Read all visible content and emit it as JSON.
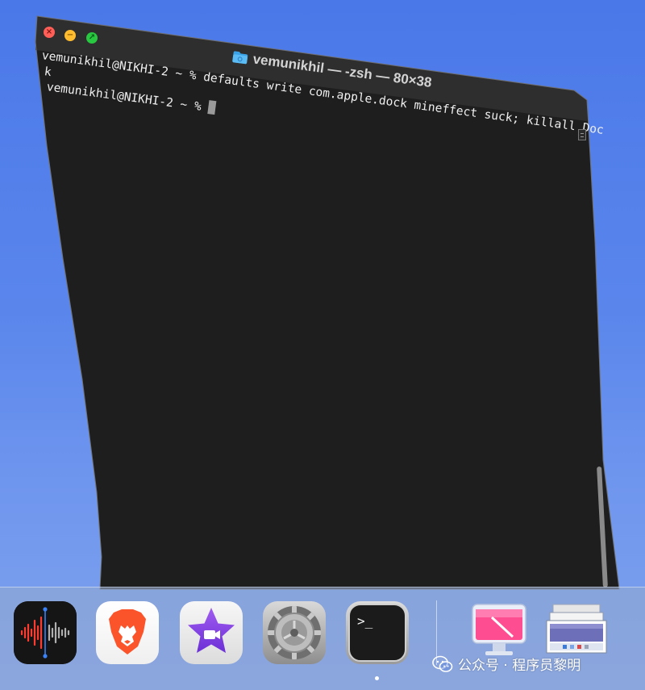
{
  "window": {
    "title": "vemunikhil — -zsh — 80×38",
    "folder_icon": "folder-icon",
    "traffic_lights": {
      "close_color": "#ff5f57",
      "minimize_color": "#febc2e",
      "zoom_color": "#28c840",
      "close_glyph": "×",
      "minimize_glyph": "−",
      "zoom_glyph": "↗"
    }
  },
  "terminal": {
    "lines": [
      "vemunikhil@NIKHI-2 ~ % defaults write com.apple.dock mineffect suck; killall Doc",
      "k",
      "vemunikhil@NIKHI-2 ~ % "
    ],
    "background_color": "#1e1e1e",
    "text_color": "#f0f0f0"
  },
  "dock": {
    "apps": [
      {
        "name": "Voice Memos",
        "icon": "voice-memos-icon"
      },
      {
        "name": "Brave Browser",
        "icon": "brave-lion-icon"
      },
      {
        "name": "iMovie",
        "icon": "imovie-star-icon"
      },
      {
        "name": "System Settings",
        "icon": "gear-icon"
      },
      {
        "name": "Terminal",
        "icon": "terminal-icon",
        "running": true
      },
      {
        "name": "CleanMyMac",
        "icon": "cleanmymac-icon"
      },
      {
        "name": "Downloads",
        "icon": "downloads-stack-icon"
      }
    ],
    "terminal_icon_text": ">_"
  },
  "watermark": {
    "text": "公众号 · 程序员黎明",
    "icon": "wechat-icon"
  }
}
